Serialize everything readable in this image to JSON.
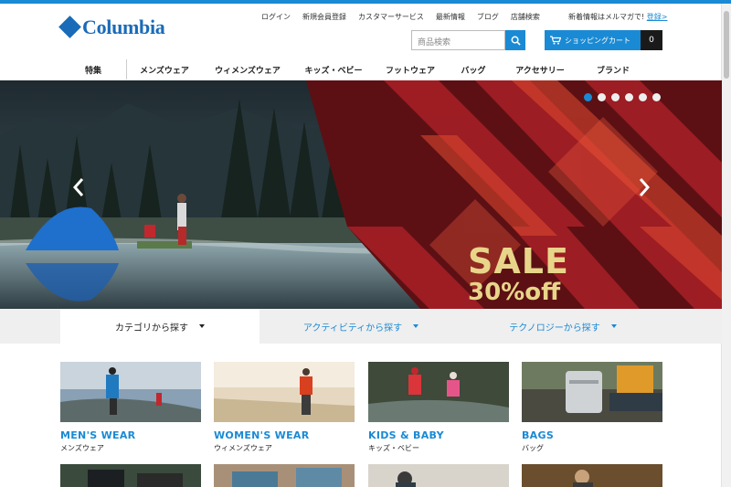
{
  "brand": {
    "name": "Columbia",
    "accent": "#1a8ad4",
    "logo_color": "#1a6bb8"
  },
  "utility_links": [
    "ログイン",
    "新規会員登録",
    "カスタマーサービス",
    "最新情報",
    "ブログ",
    "店舗検索"
  ],
  "newsletter": {
    "text": "新着情報はメルマガで!",
    "link": "登録>"
  },
  "search": {
    "placeholder": "商品検索",
    "icon": "search-icon"
  },
  "cart": {
    "label": "ショッピングカート",
    "count": "0",
    "icon": "cart-icon"
  },
  "nav": [
    "特集",
    "メンズウェア",
    "ウィメンズウェア",
    "キッズ・ベビー",
    "フットウェア",
    "バッグ",
    "アクセサリー",
    "ブランド"
  ],
  "hero": {
    "sale_line1": "SALE",
    "sale_line2": "30%off",
    "slide_count": 6,
    "active_slide": 1,
    "prev_icon": "chevron-left-icon",
    "next_icon": "chevron-right-icon"
  },
  "category_tabs": [
    {
      "label": "カテゴリから探す",
      "active": true
    },
    {
      "label": "アクティビティから探す",
      "active": false
    },
    {
      "label": "テクノロジーから探す",
      "active": false
    }
  ],
  "categories": [
    {
      "en": "MEN'S WEAR",
      "jp": "メンズウェア"
    },
    {
      "en": "WOMEN'S WEAR",
      "jp": "ウィメンズウェア"
    },
    {
      "en": "KIDS & BABY",
      "jp": "キッズ・ベビー"
    },
    {
      "en": "BAGS",
      "jp": "バッグ"
    }
  ]
}
